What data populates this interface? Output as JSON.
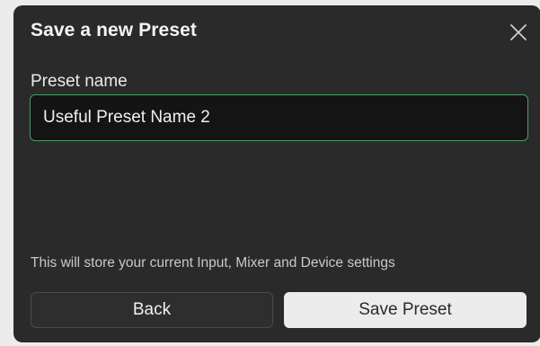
{
  "dialog": {
    "title": "Save a new Preset",
    "close_icon": "close-icon",
    "field_label": "Preset name",
    "preset_name_value": "Useful Preset Name 2",
    "info_text": "This will store your current Input, Mixer and Device settings",
    "back_label": "Back",
    "save_label": "Save Preset"
  },
  "colors": {
    "dialog_background": "#2a2a2b",
    "input_background": "#141414",
    "input_focus_border": "#4a9b6a",
    "primary_button": "#ececec"
  }
}
